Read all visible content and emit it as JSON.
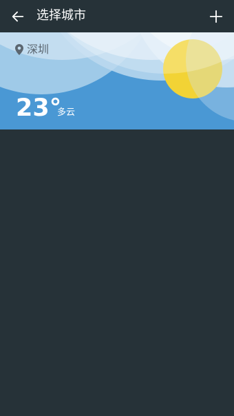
{
  "toolbar": {
    "title": "选择城市",
    "back_icon": "arrow-left-icon",
    "add_icon": "plus-icon"
  },
  "city_card": {
    "location_icon": "map-pin-icon",
    "city": "深圳",
    "temperature": "23°",
    "condition": "多云"
  },
  "colors": {
    "background": "#263238",
    "card_sky": "#4a98d4",
    "sun": "#f2d335"
  }
}
